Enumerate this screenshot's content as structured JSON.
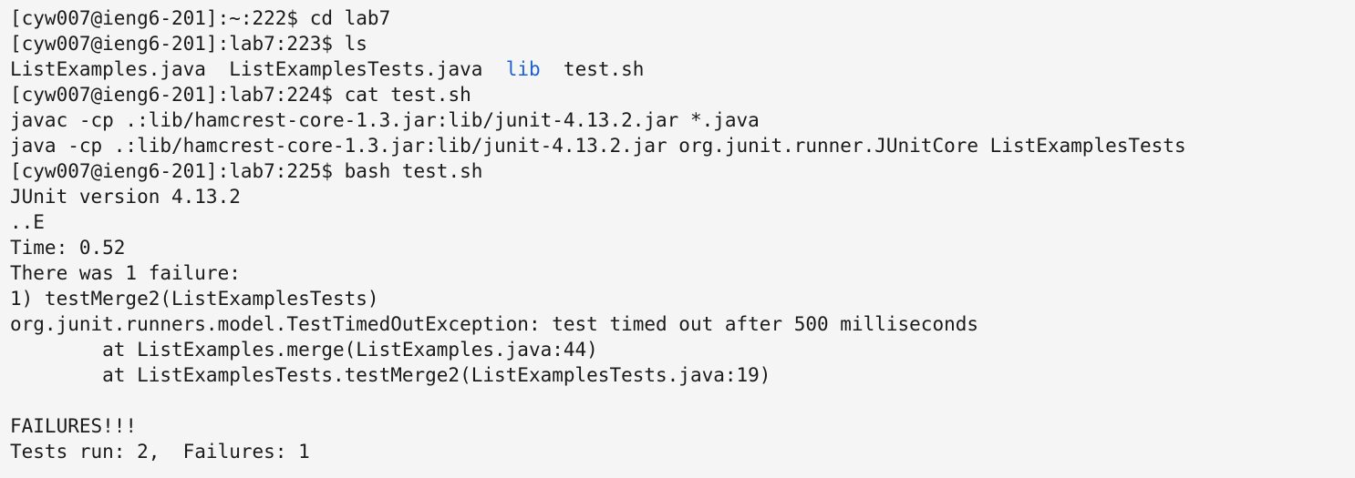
{
  "terminal": {
    "lines": [
      {
        "prompt": "[cyw007@ieng6-201]:~:222$",
        "command": " cd lab7"
      },
      {
        "prompt": "[cyw007@ieng6-201]:lab7:223$",
        "command": " ls"
      },
      {
        "listing": {
          "file1": "ListExamples.java",
          "file2": "ListExamplesTests.java",
          "dir": "lib",
          "file3": "test.sh"
        }
      },
      {
        "prompt": "[cyw007@ieng6-201]:lab7:224$",
        "command": " cat test.sh"
      },
      {
        "text": "javac -cp .:lib/hamcrest-core-1.3.jar:lib/junit-4.13.2.jar *.java"
      },
      {
        "text": "java -cp .:lib/hamcrest-core-1.3.jar:lib/junit-4.13.2.jar org.junit.runner.JUnitCore ListExamplesTests"
      },
      {
        "prompt": "[cyw007@ieng6-201]:lab7:225$",
        "command": " bash test.sh"
      },
      {
        "text": "JUnit version 4.13.2"
      },
      {
        "text": "..E"
      },
      {
        "text": "Time: 0.52"
      },
      {
        "text": "There was 1 failure:"
      },
      {
        "text": "1) testMerge2(ListExamplesTests)"
      },
      {
        "text": "org.junit.runners.model.TestTimedOutException: test timed out after 500 milliseconds"
      },
      {
        "text": "        at ListExamples.merge(ListExamples.java:44)"
      },
      {
        "text": "        at ListExamplesTests.testMerge2(ListExamplesTests.java:19)"
      },
      {
        "text": ""
      },
      {
        "text": "FAILURES!!!"
      },
      {
        "text": "Tests run: 2,  Failures: 1"
      }
    ]
  },
  "colors": {
    "background": "#f5f5f5",
    "text": "#1a1a1a",
    "directory": "#1a5fd6"
  }
}
